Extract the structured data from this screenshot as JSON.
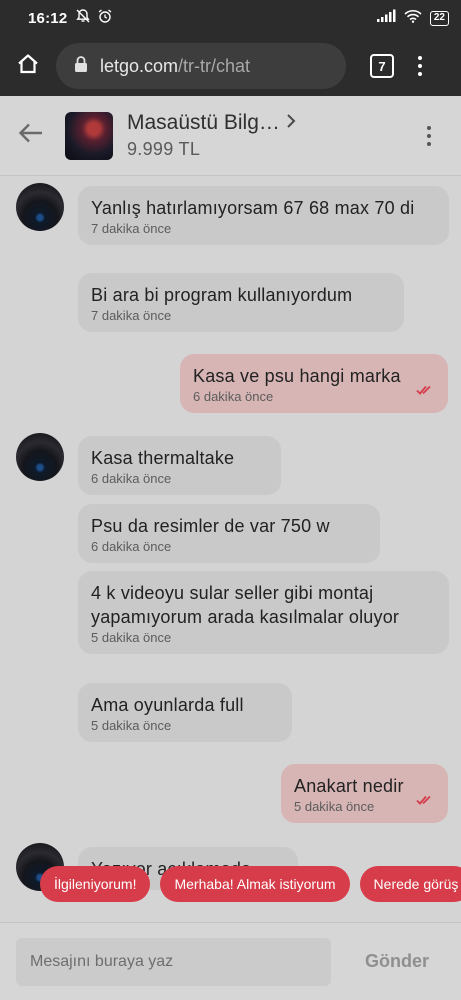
{
  "status_bar": {
    "time": "16:12",
    "battery": "22"
  },
  "browser": {
    "url_host": "letgo.com",
    "url_path": "/tr-tr/chat",
    "tab_count": "7"
  },
  "chat_header": {
    "title": "Masaüstü Bilg…",
    "price": "9.999 TL"
  },
  "messages": [
    {
      "direction": "in",
      "text": "Yanlış hatırlamıyorsam  67 68 max 70 di",
      "time": "7 dakika önce"
    },
    {
      "direction": "in",
      "text": "Bi ara bi program kullanıyordum",
      "time": "7 dakika önce"
    },
    {
      "direction": "out",
      "text": "Kasa ve psu hangi marka",
      "time": "6 dakika önce"
    },
    {
      "direction": "in",
      "text": "Kasa thermaltake",
      "time": "6 dakika önce"
    },
    {
      "direction": "in",
      "text": "Psu da resimler de var 750 w",
      "time": "6 dakika önce"
    },
    {
      "direction": "in",
      "text": "4 k videoyu sular seller gibi montaj yapamıyorum arada kasılmalar oluyor",
      "time": "5 dakika önce"
    },
    {
      "direction": "in",
      "text": "Ama oyunlarda full",
      "time": "5 dakika önce"
    },
    {
      "direction": "out",
      "text": "Anakart nedir",
      "time": "5 dakika önce"
    },
    {
      "direction": "in",
      "text": "Yazıyor açıklamada",
      "time": ""
    }
  ],
  "quick_replies": [
    "İlgileniyorum!",
    "Merhaba! Almak istiyorum",
    "Nerede görüş"
  ],
  "composer": {
    "placeholder": "Mesajını buraya yaz",
    "send_label": "Gönder"
  },
  "colors": {
    "accent": "#d63c4a",
    "outgoing_bubble": "#d8b5b5",
    "incoming_bubble": "#c9c9c9",
    "read_ticks": "#d63c4a"
  }
}
